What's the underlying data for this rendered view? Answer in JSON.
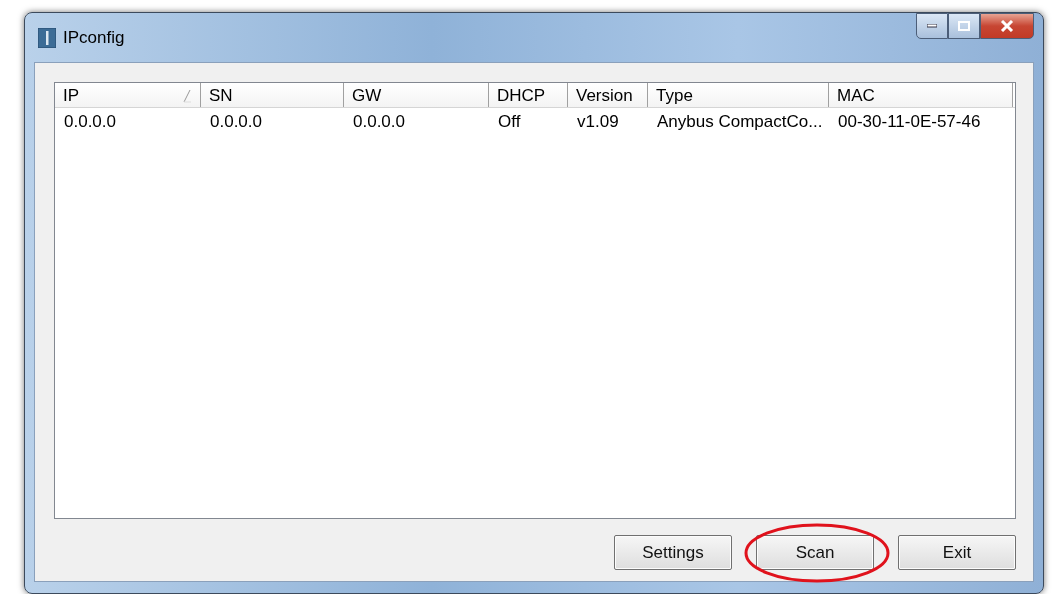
{
  "window": {
    "title": "IPconfig"
  },
  "table": {
    "columns": [
      {
        "label": "IP",
        "sorted": true
      },
      {
        "label": "SN",
        "sorted": false
      },
      {
        "label": "GW",
        "sorted": false
      },
      {
        "label": "DHCP",
        "sorted": false
      },
      {
        "label": "Version",
        "sorted": false
      },
      {
        "label": "Type",
        "sorted": false
      },
      {
        "label": "MAC",
        "sorted": false
      }
    ],
    "rows": [
      [
        "0.0.0.0",
        "0.0.0.0",
        "0.0.0.0",
        "Off",
        "v1.09",
        "Anybus CompactCo...",
        "00-30-11-0E-57-46"
      ]
    ]
  },
  "buttons": [
    {
      "label": "Settings",
      "circled": false
    },
    {
      "label": "Scan",
      "circled": true
    },
    {
      "label": "Exit",
      "circled": false
    }
  ]
}
